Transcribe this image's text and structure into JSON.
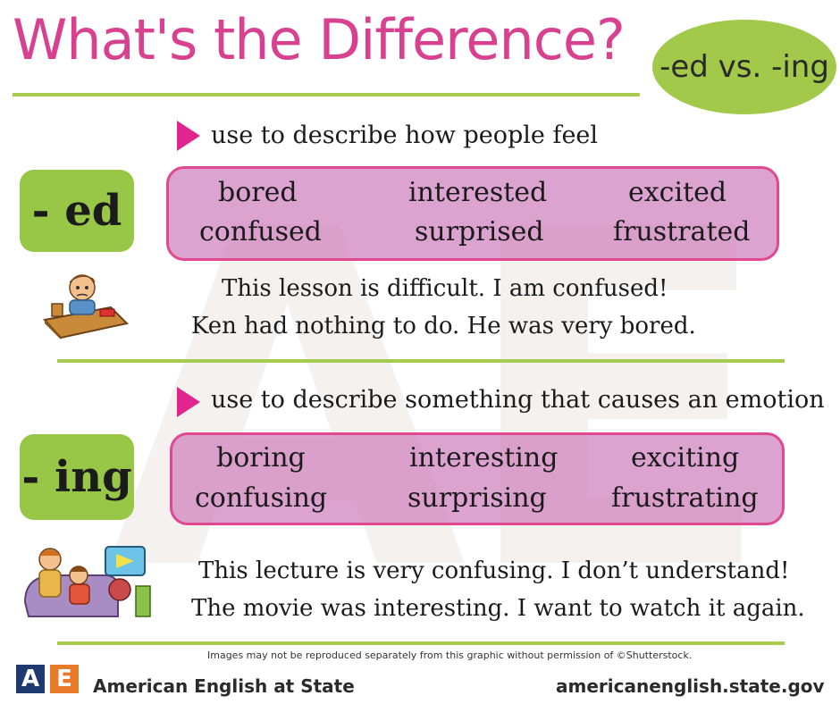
{
  "title": "What's the Difference?",
  "badge": "-ed vs. -ing",
  "ed_section": {
    "description": "use to describe how people feel",
    "tag": "- ed",
    "words": [
      "bored",
      "interested",
      "excited",
      "confused",
      "surprised",
      "frustrated"
    ],
    "examples": [
      "This lesson is difficult. I am confused!",
      "Ken had nothing to do. He was very bored."
    ]
  },
  "ing_section": {
    "description": "use to describe  something that causes an emotion",
    "tag": "- ing",
    "words": [
      "boring",
      "interesting",
      "exciting",
      "confusing",
      "surprising",
      "frustrating"
    ],
    "examples": [
      "This lecture is very confusing. I don’t understand!",
      "The movie was interesting.  I want to watch it again."
    ]
  },
  "footer": {
    "note": "Images may not be reproduced separately from this graphic without permission of ©Shutterstock.",
    "logo_a": "A",
    "logo_e": "E",
    "brand": "American English at State",
    "url": "americanenglish.state.gov"
  },
  "colors": {
    "title_pink": "#d8418f",
    "accent_green": "#a3c94a",
    "word_box": "#d080be",
    "arrow_magenta": "#e0258f",
    "logo_blue": "#1f3a6e",
    "logo_orange": "#e87b2a"
  }
}
